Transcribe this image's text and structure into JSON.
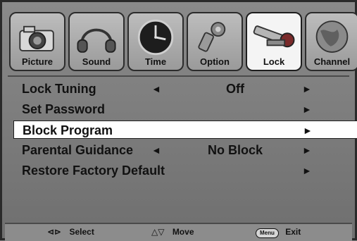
{
  "tabs": [
    {
      "label": "Picture",
      "icon": "camera-icon",
      "active": false
    },
    {
      "label": "Sound",
      "icon": "headphones-icon",
      "active": false
    },
    {
      "label": "Time",
      "icon": "clock-icon",
      "active": false
    },
    {
      "label": "Option",
      "icon": "gear-icon",
      "active": false
    },
    {
      "label": "Lock",
      "icon": "lock-icon",
      "active": true
    },
    {
      "label": "Channel",
      "icon": "globe-icon",
      "active": false
    }
  ],
  "menu": {
    "items": [
      {
        "label": "Lock Tuning",
        "value": "Off",
        "left_arrow": "◄",
        "right_arrow": "►"
      },
      {
        "label": "Set Password",
        "value": "",
        "left_arrow": "",
        "right_arrow": "►"
      },
      {
        "label": "Block Program",
        "value": "",
        "left_arrow": "",
        "right_arrow": "►",
        "selected": true
      },
      {
        "label": "Parental Guidance",
        "value": "No Block",
        "left_arrow": "◄",
        "right_arrow": "►"
      },
      {
        "label": "Restore Factory Default",
        "value": "",
        "left_arrow": "",
        "right_arrow": "►"
      }
    ]
  },
  "help": {
    "select_label": "Select",
    "move_label": "Move",
    "menu_key": "Menu",
    "exit_label": "Exit"
  }
}
